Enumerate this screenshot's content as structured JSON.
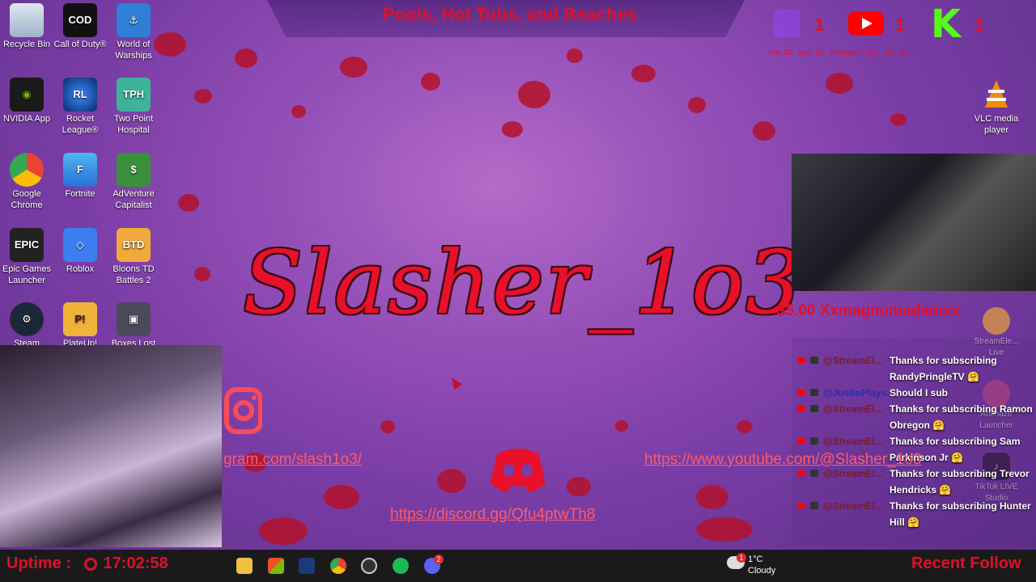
{
  "overlay": {
    "top_title": "Pools, Hot Tubs, and Beaches",
    "channel_name": "Slasher_1o3",
    "ticker": "$5.00   Xxmagnumadamxx",
    "uptime_label": "Uptime :",
    "uptime_value": "17:02:58",
    "recent_follow_label": "Recent Follow",
    "social_counts": [
      "1",
      "1",
      "1"
    ],
    "social_strip": "Mar 26 · Sub: 31 · Followers · 127 · 26 · 24",
    "links": {
      "instagram": "gram.com/slash1o3/",
      "youtube": "https://www.youtube.com/@Slasher_1o3",
      "discord": "https://discord.gg/Qfu4ptwTh8"
    }
  },
  "desktop_icons": [
    {
      "label": "Recycle Bin"
    },
    {
      "label": "Call of Duty®"
    },
    {
      "label": "World of Warships"
    },
    {
      "label": "NVIDIA App"
    },
    {
      "label": "Rocket League®"
    },
    {
      "label": "Two Point Hospital"
    },
    {
      "label": "Google Chrome"
    },
    {
      "label": "Fortnite"
    },
    {
      "label": "AdVenture Capitalist"
    },
    {
      "label": "Epic Games Launcher"
    },
    {
      "label": "Roblox"
    },
    {
      "label": "Bloons TD Battles 2"
    },
    {
      "label": "Steam"
    },
    {
      "label": "PlateUp!"
    },
    {
      "label": "Boxes Lost"
    },
    {
      "label": "VLC media player"
    },
    {
      "label": "StreamEle... Live"
    },
    {
      "label": "Animaze Launcher"
    },
    {
      "label": "TikTok LIVE Studio"
    }
  ],
  "chat": [
    {
      "user": "@StreamEl...",
      "message": "Thanks for subscribing RandyPringleTV 🤗"
    },
    {
      "user": "@JustinPlays...",
      "message": "Should I sub"
    },
    {
      "user": "@StreamEl...",
      "message": "Thanks for subscribing Ramon Obregon 🤗"
    },
    {
      "user": "@StreamEl...",
      "message": "Thanks for subscribing Sam Parkinson Jr 🤗"
    },
    {
      "user": "@StreamEl...",
      "message": "Thanks for subscribing Trevor Hendricks 🤗"
    },
    {
      "user": "@StreamEl...",
      "message": "Thanks for subscribing Hunter Hill 🤗"
    }
  ],
  "taskbar": {
    "weather_temp": "1°C",
    "weather_cond": "Cloudy",
    "notification_count": "1",
    "discord_badge": "2"
  },
  "colors": {
    "accent_red": "#e0102a",
    "background_purple": "#8a4bb0",
    "taskbar": "#1a1a1a"
  }
}
